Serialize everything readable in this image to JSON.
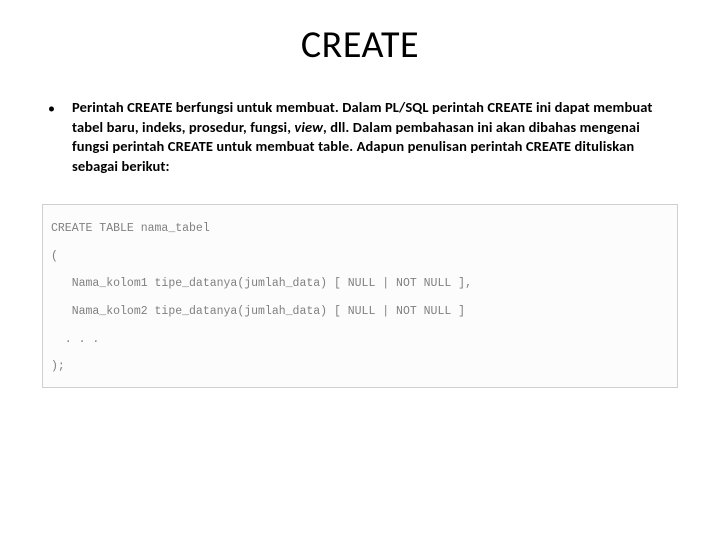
{
  "title": "CREATE",
  "bullet": "•",
  "paragraph_parts": {
    "p1": "Perintah CREATE berfungsi untuk membuat. Dalam PL/SQL perintah CREATE ini dapat membuat tabel baru, indeks, prosedur, fungsi, ",
    "p1_italic": "view",
    "p2": ", dll. Dalam pembahasan ini akan dibahas mengenai fungsi perintah CREATE untuk membuat table. Adapun penulisan perintah CREATE dituliskan sebagai berikut:"
  },
  "code": "CREATE TABLE nama_tabel\n(\n   Nama_kolom1 tipe_datanya(jumlah_data) [ NULL | NOT NULL ],\n   Nama_kolom2 tipe_datanya(jumlah_data) [ NULL | NOT NULL ]\n  . . .\n);"
}
